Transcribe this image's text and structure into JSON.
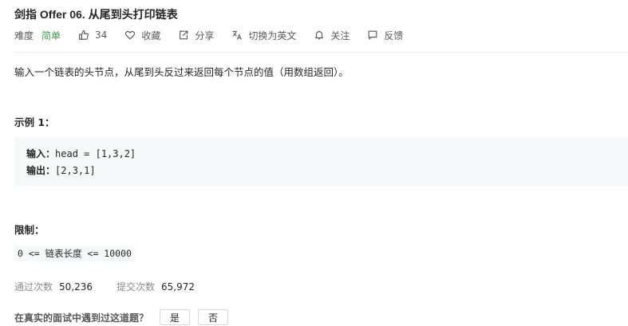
{
  "problem": {
    "title": "剑指 Offer 06. 从尾到头打印链表",
    "difficulty_label": "难度",
    "difficulty_value": "简单",
    "actions": {
      "likes": "34",
      "favorite": "收藏",
      "share": "分享",
      "switch_lang": "切换为英文",
      "follow": "关注",
      "feedback": "反馈"
    },
    "description": "输入一个链表的头节点，从尾到头反过来返回每个节点的值（用数组返回）。",
    "example": {
      "title": "示例 1：",
      "input_label": "输入：",
      "input_value": "head = [1,3,2]",
      "output_label": "输出：",
      "output_value": "[2,3,1]"
    },
    "limits": {
      "title": "限制：",
      "code": "0 <= 链表长度 <= 10000"
    },
    "stats": {
      "accepted_label": "通过次数",
      "accepted_value": "50,236",
      "submitted_label": "提交次数",
      "submitted_value": "65,972"
    },
    "interview_question": {
      "text": "在真实的面试中遇到过这道题？",
      "yes": "是",
      "no": "否"
    }
  },
  "colors": {
    "easy_green": "#43a047",
    "code_bg": "#f7f8fa"
  }
}
